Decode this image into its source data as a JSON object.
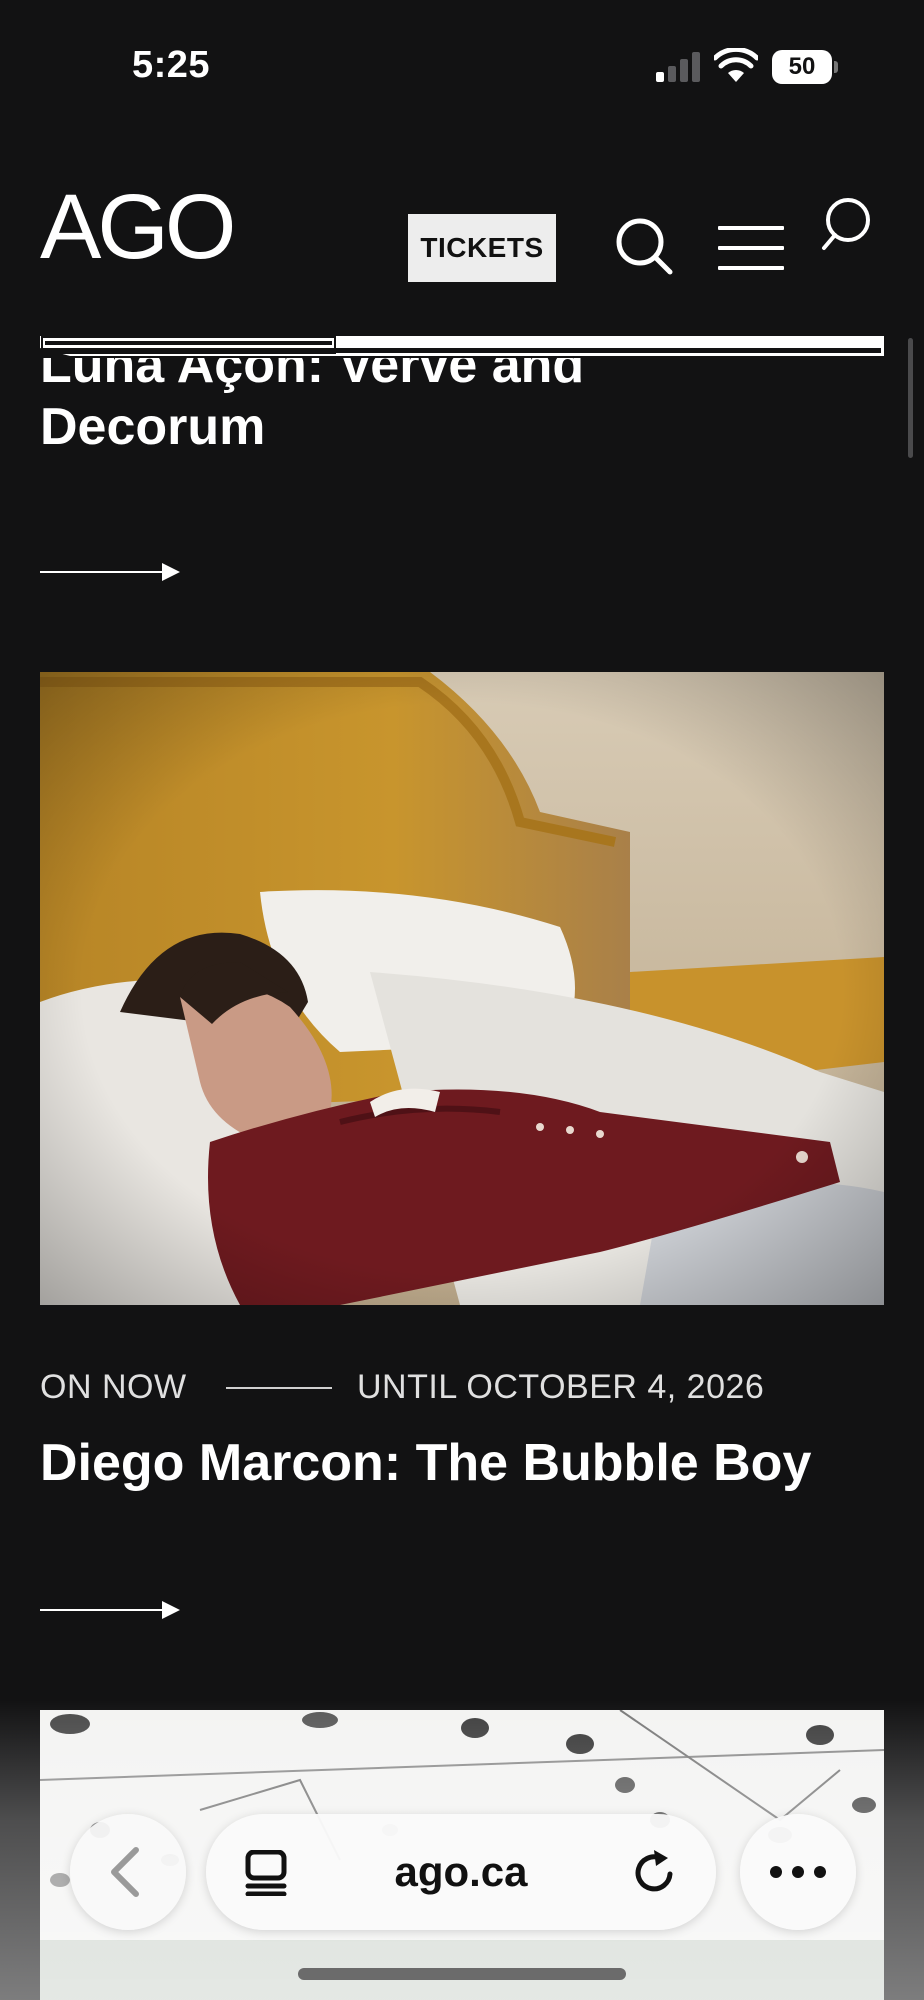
{
  "status_bar": {
    "time": "5:25",
    "battery": "50",
    "signal_bars_active": 1,
    "signal_bars_total": 4
  },
  "header": {
    "logo_text": "AGO",
    "tickets_label": "TICKETS",
    "icons": [
      "search-icon",
      "menu-icon",
      "search-icon"
    ]
  },
  "carousel": {
    "progress_fraction": 0.35
  },
  "articles": [
    {
      "title": "Luna Açon: Verve and Decorum",
      "title_line_1": "Luna Açon: Verve and",
      "title_line_2": "Decorum"
    },
    {
      "status": "ON NOW",
      "until": "UNTIL OCTOBER 4, 2026",
      "title": "Diego Marcon: The Bubble Boy"
    }
  ],
  "browser": {
    "url": "ago.ca",
    "icons": [
      "back-chevron-icon",
      "tabs-icon",
      "reload-icon",
      "more-dots-icon"
    ]
  },
  "colors": {
    "background": "#121213",
    "text": "#ffffff",
    "tickets_bg": "#ededed"
  }
}
